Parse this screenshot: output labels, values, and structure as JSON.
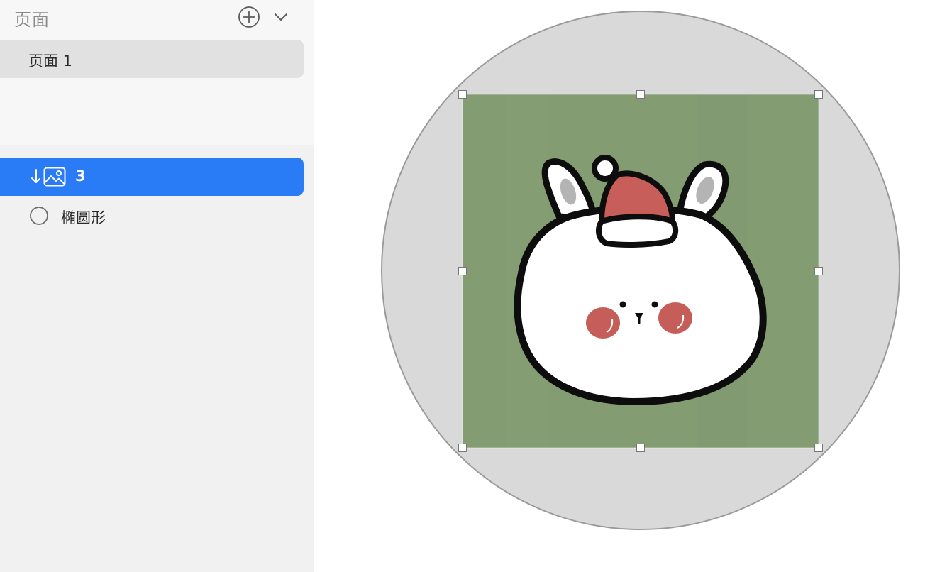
{
  "sidebar": {
    "pages_header": {
      "title": "页面",
      "add_icon": "plus-circle-icon",
      "collapse_icon": "chevron-down-icon"
    },
    "pages": [
      {
        "label": "页面 1",
        "selected": true
      }
    ],
    "layers": [
      {
        "label": "3",
        "type": "image",
        "masked": true,
        "selected": true,
        "icons": [
          "mask-arrow-icon",
          "image-icon"
        ]
      },
      {
        "label": "椭圆形",
        "type": "oval",
        "selected": false,
        "icons": [
          "oval-icon"
        ]
      }
    ]
  },
  "colors": {
    "selection_blue": "#2a7bf6",
    "sidebar_bg": "#f1f1f2",
    "page_item_bg": "#e1e1e1",
    "canvas_circle_fill": "#d9d9d9",
    "image_bg_green": "#839c72",
    "hat_red": "#c75e5a",
    "cheek_red": "#c55e59"
  }
}
